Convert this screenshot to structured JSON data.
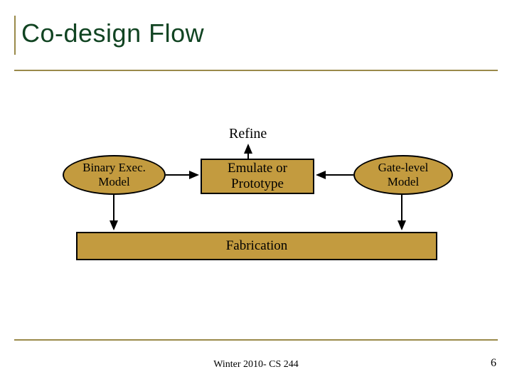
{
  "header": {
    "title": "Co-design Flow"
  },
  "labels": {
    "refine": "Refine"
  },
  "nodes": {
    "binary_exec": "Binary Exec.\nModel",
    "emulate": "Emulate or\nPrototype",
    "gate_level": "Gate-level\nModel",
    "fabrication": "Fabrication"
  },
  "footer": {
    "center": "Winter 2010- CS 244",
    "page": "6"
  },
  "colors": {
    "accent_border": "#9a8a4a",
    "title_color": "#114422",
    "box_fill": "#c39b3f"
  }
}
